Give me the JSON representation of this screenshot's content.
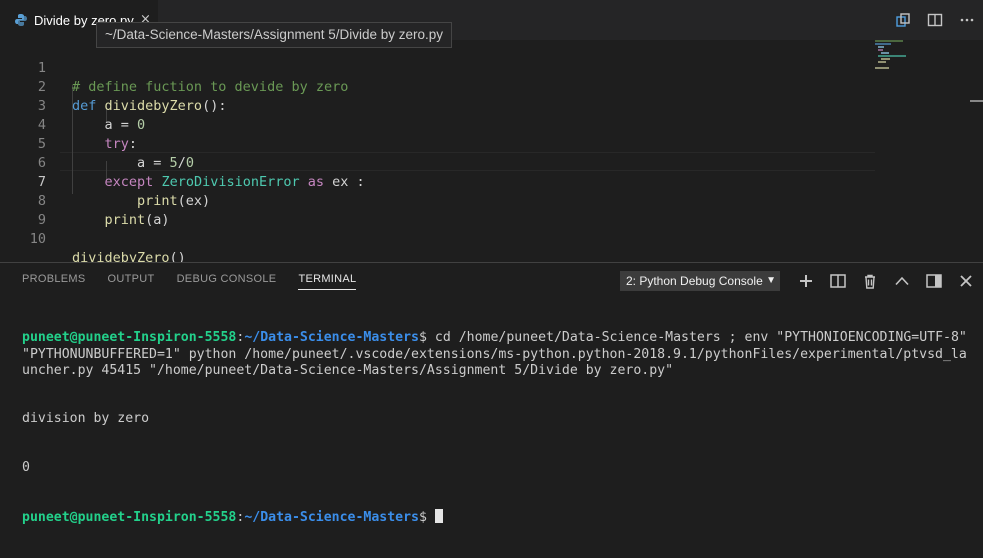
{
  "tab": {
    "title": "Divide by zero.py",
    "close": "×"
  },
  "tooltip": "~/Data-Science-Masters/Assignment 5/Divide by zero.py",
  "editor_actions": [
    "open-changes-icon",
    "split-editor-icon",
    "more-actions-icon"
  ],
  "editor": {
    "current_line": 7,
    "lines": [
      {
        "n": "1",
        "text": "# define fuction to devide by zero"
      },
      {
        "n": "2",
        "text": "def dividebyZero():"
      },
      {
        "n": "3",
        "text": "    a = 0"
      },
      {
        "n": "4",
        "text": "    try:"
      },
      {
        "n": "5",
        "text": "        a = 5/0"
      },
      {
        "n": "6",
        "text": "    except ZeroDivisionError as ex :"
      },
      {
        "n": "7",
        "text": "        print(ex)"
      },
      {
        "n": "8",
        "text": "    print(a)"
      },
      {
        "n": "9",
        "text": ""
      },
      {
        "n": "10",
        "text": "dividebyZero()"
      }
    ]
  },
  "panel": {
    "tabs": [
      "PROBLEMS",
      "OUTPUT",
      "DEBUG CONSOLE",
      "TERMINAL"
    ],
    "active_tab": "TERMINAL",
    "terminal_select": "2: Python Debug Console",
    "actions": [
      "add-terminal-icon",
      "split-terminal-icon",
      "trash-icon",
      "maximize-panel-icon",
      "toggle-panel-icon",
      "close-panel-icon"
    ],
    "terminal": {
      "prompt_user": "puneet@puneet-Inspiron-5558",
      "prompt_sep": ":",
      "prompt_path": "~/Data-Science-Masters",
      "prompt_end": "$ ",
      "command": "cd /home/puneet/Data-Science-Masters ; env \"PYTHONIOENCODING=UTF-8\" \"PYTHONUNBUFFERED=1\" python /home/puneet/.vscode/extensions/ms-python.python-2018.9.1/pythonFiles/experimental/ptvsd_launcher.py 45415 \"/home/puneet/Data-Science-Masters/Assignment 5/Divide by zero.py\"",
      "output": [
        "division by zero",
        "0"
      ]
    }
  },
  "colors": {
    "background": "#1e1e1e",
    "prompt_user": "#23d18b",
    "prompt_path": "#3b8eea",
    "keyword": "#569cd6",
    "control": "#c586c0",
    "function": "#dcdcaa",
    "number": "#b5cea8",
    "class": "#4ec9b0",
    "comment": "#6a9955"
  }
}
